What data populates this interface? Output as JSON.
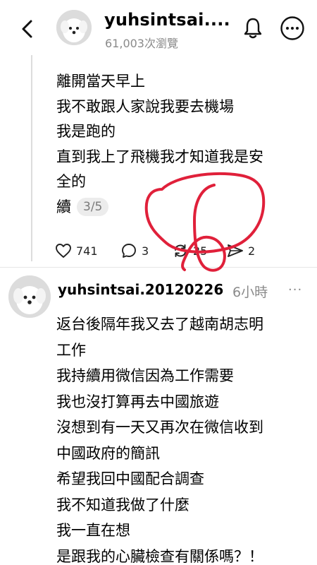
{
  "header": {
    "username": "yuhsintsai....",
    "views": "61,003次瀏覽",
    "back_icon": "back-arrow-icon",
    "bell_icon": "bell-icon",
    "more_icon": "more-circle-icon"
  },
  "post1": {
    "lines": [
      "離開當天早上",
      "我不敢跟人家說我要去機場",
      "我是跑的",
      "直到我上了飛機我才知道我是安",
      "全的"
    ],
    "last_line": "續",
    "counter": "3/5",
    "likes": "741",
    "comments": "3",
    "reposts": "25",
    "shares": "2"
  },
  "post2": {
    "username": "yuhsintsai.20120226",
    "time": "6小時",
    "more": "···",
    "lines": [
      "返台後隔年我又去了越南胡志明",
      "工作",
      "我持續用微信因為工作需要",
      "我也沒打算再去中國旅遊",
      "沒想到有一天又再次在微信收到",
      "中國政府的簡訊",
      "希望我回中國配合調查",
      "我不知道我做了什麼",
      "我一直在想",
      "是跟我的心臟檢查有關係嗎？！"
    ]
  },
  "colors": {
    "secondary_text": "#8a8a8a",
    "scribble": "#e0203a"
  }
}
